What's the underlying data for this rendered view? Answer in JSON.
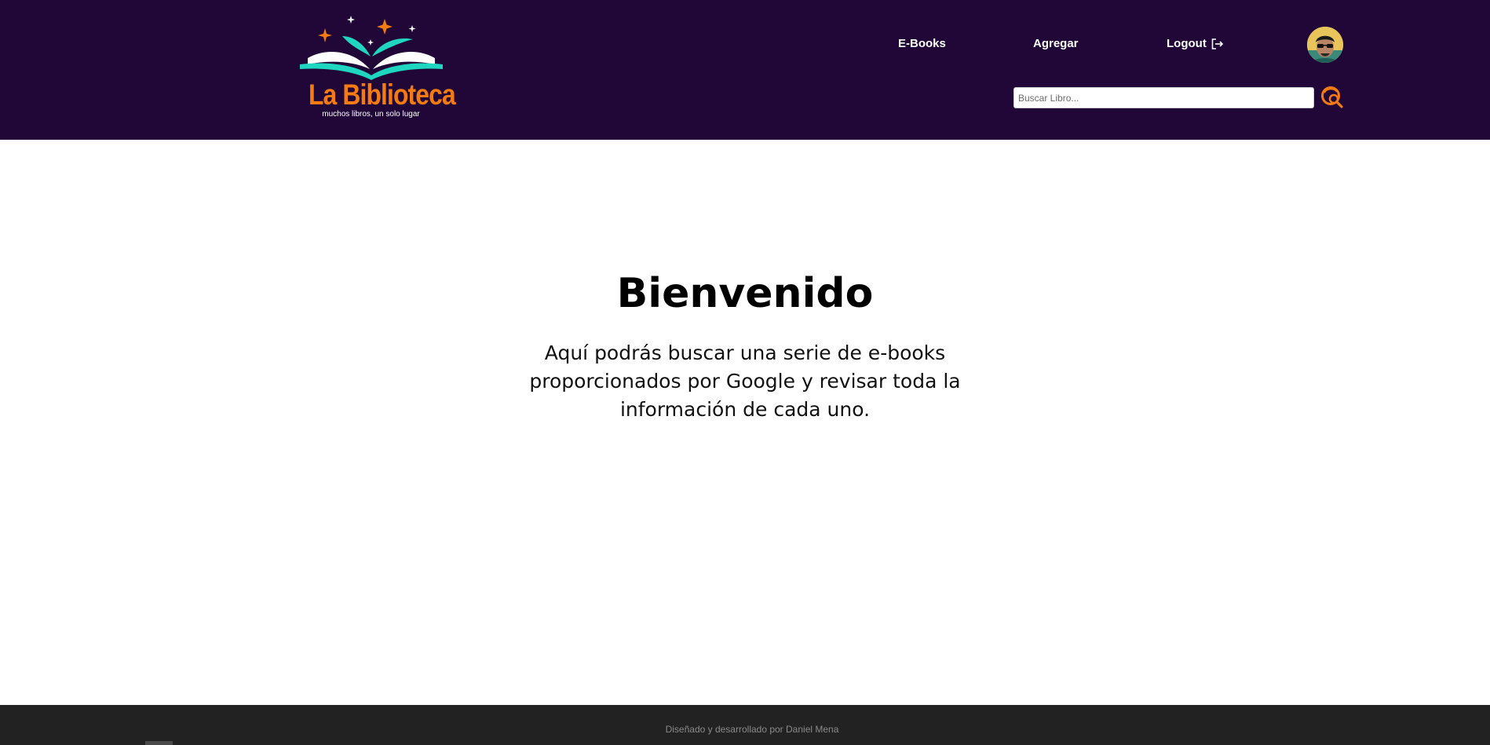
{
  "header": {
    "logo": {
      "title": "La Biblioteca",
      "tagline": "muchos libros, un solo lugar"
    },
    "nav": {
      "ebooks_label": "E-Books",
      "agregar_label": "Agregar",
      "logout_label": "Logout",
      "logout_icon": "logout-icon"
    },
    "avatar_icon": "user-avatar",
    "search": {
      "placeholder": "Buscar Libro...",
      "value": "",
      "button_icon": "search-icon"
    }
  },
  "main": {
    "title": "Bienvenido",
    "description": "Aquí podrás buscar una serie de e-books proporcionados por Google y revisar toda la información de cada uno."
  },
  "footer": {
    "text": "Diseñado y desarrollado por Daniel Mena"
  },
  "colors": {
    "header_bg": "#200737",
    "accent_orange": "#f47a12",
    "accent_teal": "#1fd6c1",
    "footer_bg": "#222222"
  }
}
